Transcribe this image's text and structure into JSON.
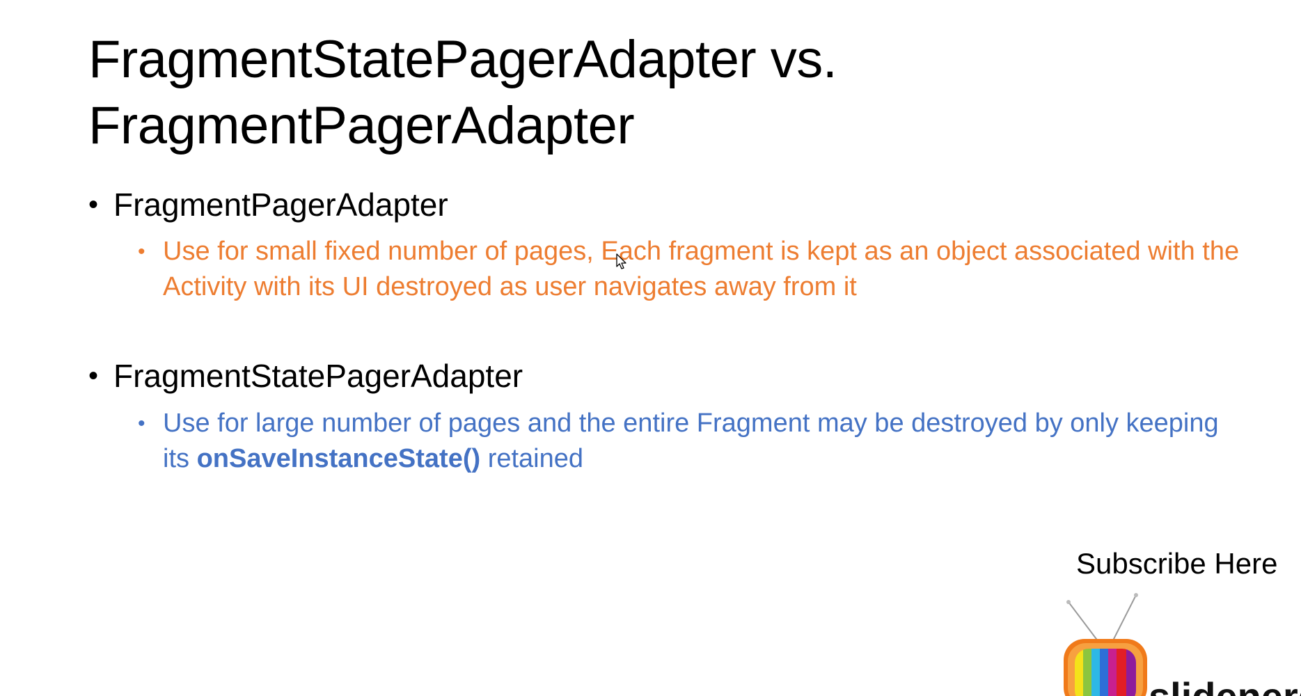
{
  "slide": {
    "title_line1": "FragmentStatePagerAdapter vs.",
    "title_line2": "FragmentPagerAdapter",
    "bullets": [
      {
        "label": "FragmentPagerAdapter",
        "sub": "Use for small fixed number of pages, Each fragment is kept as an object associated with the Activity with its UI destroyed as user navigates away from it",
        "sub_color": "#ED7D31"
      },
      {
        "label": "FragmentStatePagerAdapter",
        "sub_before": "Use for large number of pages and the entire Fragment may be destroyed by only keeping its ",
        "sub_bold": "onSaveInstanceState()",
        "sub_after": " retained",
        "sub_color": "#4472C4"
      }
    ],
    "bullet_glyph": "•"
  },
  "branding": {
    "subscribe_text": "Subscribe Here",
    "logo_text": "slidenerd"
  },
  "icons": {
    "cursor": "mouse-pointer-icon",
    "tv": "tv-icon"
  }
}
